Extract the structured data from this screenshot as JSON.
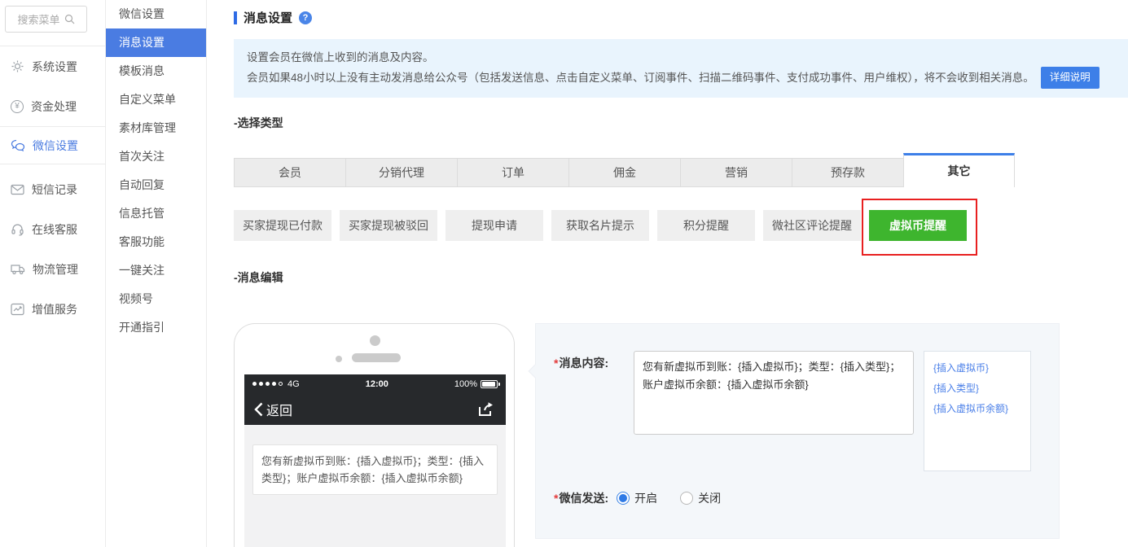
{
  "sidebar": {
    "search_placeholder": "搜索菜单",
    "items": [
      {
        "label": "系统设置",
        "icon": "gear-icon"
      },
      {
        "label": "资金处理",
        "icon": "yuan-icon"
      },
      {
        "label": "微信设置",
        "icon": "wechat-icon"
      },
      {
        "label": "短信记录",
        "icon": "envelope-icon"
      },
      {
        "label": "在线客服",
        "icon": "headset-icon"
      },
      {
        "label": "物流管理",
        "icon": "truck-icon"
      },
      {
        "label": "增值服务",
        "icon": "trend-chart-icon"
      }
    ],
    "active_item": "微信设置"
  },
  "submenu": {
    "items": [
      "微信设置",
      "消息设置",
      "模板消息",
      "自定义菜单",
      "素材库管理",
      "首次关注",
      "自动回复",
      "信息托管",
      "客服功能",
      "一键关注",
      "视频号",
      "开通指引"
    ],
    "selected": "消息设置"
  },
  "page": {
    "title": "消息设置",
    "notice_line1": "设置会员在微信上收到的消息及内容。",
    "notice_line2": "会员如果48小时以上没有主动发消息给公众号（包括发送信息、点击自定义菜单、订阅事件、扫描二维码事件、支付成功事件、用户维权），将不会收到相关消息。",
    "notice_button": "详细说明",
    "section_select_type": "-选择类型",
    "section_message_edit": "-消息编辑",
    "tabs": [
      "会员",
      "分销代理",
      "订单",
      "佣金",
      "营销",
      "预存款",
      "其它"
    ],
    "active_tab": "其它",
    "type_buttons": [
      "买家提现已付款",
      "买家提现被驳回",
      "提现申请",
      "获取名片提示",
      "积分提醒",
      "微社区评论提醒",
      "虚拟币提醒"
    ],
    "active_type_button": "虚拟币提醒"
  },
  "phone": {
    "network": "4G",
    "time": "12:00",
    "battery": "100%",
    "back": "返回",
    "message": "您有新虚拟币到账：{插入虚拟币}；类型：{插入类型}；账户虚拟币余额：{插入虚拟币余额}"
  },
  "form": {
    "required_marker": "*",
    "content_label": "消息内容:",
    "content_value": "您有新虚拟币到账：{插入虚拟币}；类型：{插入类型}；账户虚拟币余额：{插入虚拟币余额}",
    "insert_links": [
      "{插入虚拟币}",
      "{插入类型}",
      "{插入虚拟币余额}"
    ],
    "send_label": "微信发送:",
    "option_on": "开启",
    "option_off": "关闭",
    "selected_option": "开启"
  },
  "colors": {
    "accent_blue": "#4a7ce2",
    "link_blue": "#4a7fe8",
    "active_green": "#3eb52e",
    "annotation_red": "#e82020",
    "notice_bg": "#e9f4fd",
    "phone_bar_dark": "#27292c"
  }
}
